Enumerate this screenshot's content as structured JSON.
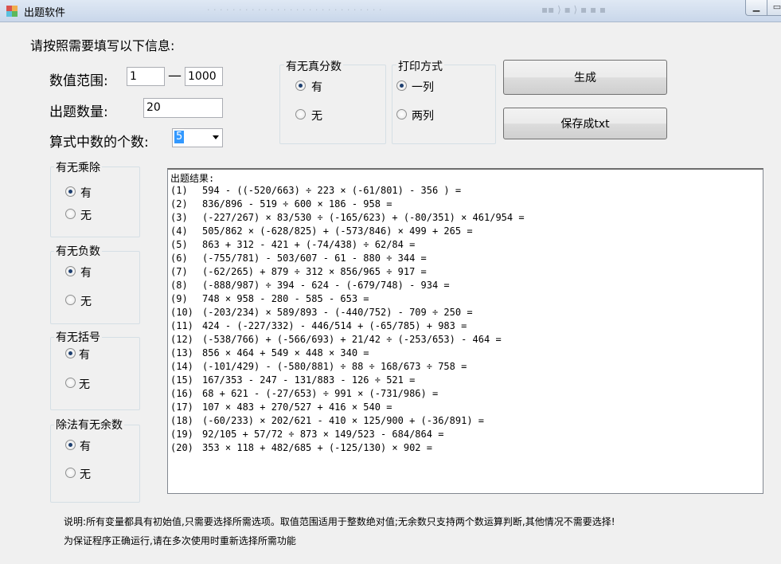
{
  "window": {
    "title": "出题软件",
    "url_ghost": "· · · · · · · · · · · · · · · · · · · · · · · · · · · ·",
    "tools_ghost": "▪▪ ⟩ ▪ ⟩ ▪ ▪ ▪",
    "min_label": "▁",
    "max_label": "▭"
  },
  "form": {
    "intro": "请按照需要填写以下信息:",
    "range_label": "数值范围:",
    "range_min": "1",
    "range_dash": "—",
    "range_max": "1000",
    "count_label": "出题数量:",
    "count_value": "20",
    "operands_label": "算式中数的个数:",
    "operands_value": "5"
  },
  "groups": {
    "fraction": {
      "title": "有无真分数",
      "yes": "有",
      "no": "无",
      "selected": "yes"
    },
    "print": {
      "title": "打印方式",
      "one": "一列",
      "two": "两列",
      "selected": "one"
    },
    "muldiv": {
      "title": "有无乘除",
      "yes": "有",
      "no": "无",
      "selected": "yes"
    },
    "negative": {
      "title": "有无负数",
      "yes": "有",
      "no": "无",
      "selected": "yes"
    },
    "brackets": {
      "title": "有无括号",
      "yes": "有",
      "no": "无",
      "selected": "yes"
    },
    "remainder": {
      "title": "除法有无余数",
      "yes": "有",
      "no": "无",
      "selected": "yes"
    }
  },
  "buttons": {
    "generate": "生成",
    "save": "保存成txt"
  },
  "results": {
    "header": "出题结果:",
    "items": [
      {
        "n": "(1)",
        "expr": "594 - ((-520/663) ÷ 223 × (-61/801) - 356 ) ="
      },
      {
        "n": "(2)",
        "expr": "836/896 - 519 ÷ 600 × 186 - 958 ="
      },
      {
        "n": "(3)",
        "expr": "(-227/267) × 83/530 ÷ (-165/623) + (-80/351) × 461/954 ="
      },
      {
        "n": "(4)",
        "expr": "505/862 × (-628/825) + (-573/846) × 499 + 265 ="
      },
      {
        "n": "(5)",
        "expr": "863 + 312 - 421 + (-74/438) ÷ 62/84 ="
      },
      {
        "n": "(6)",
        "expr": "(-755/781) - 503/607 - 61 - 880 ÷ 344 ="
      },
      {
        "n": "(7)",
        "expr": "(-62/265) + 879 ÷ 312 × 856/965 ÷ 917 ="
      },
      {
        "n": "(8)",
        "expr": "(-888/987) ÷ 394 - 624 - (-679/748) - 934 ="
      },
      {
        "n": "(9)",
        "expr": "748 × 958 - 280 - 585 - 653 ="
      },
      {
        "n": "(10)",
        "expr": "(-203/234) × 589/893 - (-440/752) - 709 ÷ 250 ="
      },
      {
        "n": "(11)",
        "expr": "424 - (-227/332) - 446/514 + (-65/785) + 983 ="
      },
      {
        "n": "(12)",
        "expr": "(-538/766) + (-566/693) + 21/42 ÷ (-253/653) - 464 ="
      },
      {
        "n": "(13)",
        "expr": "856 × 464 + 549 × 448 × 340 ="
      },
      {
        "n": "(14)",
        "expr": "(-101/429) - (-580/881) ÷ 88 ÷ 168/673 ÷ 758 ="
      },
      {
        "n": "(15)",
        "expr": "167/353 - 247 - 131/883 - 126 ÷ 521 ="
      },
      {
        "n": "(16)",
        "expr": "68 + 621 - (-27/653) ÷ 991 × (-731/986) ="
      },
      {
        "n": "(17)",
        "expr": "107 × 483 + 270/527 + 416 × 540 ="
      },
      {
        "n": "(18)",
        "expr": "(-60/233) × 202/621 - 410 × 125/900 + (-36/891) ="
      },
      {
        "n": "(19)",
        "expr": "92/105 + 57/72 ÷ 873 × 149/523 - 684/864 ="
      },
      {
        "n": "(20)",
        "expr": "353 × 118 + 482/685 + (-125/130) × 902 ="
      }
    ]
  },
  "notes": {
    "line1": "说明:所有变量都具有初始值,只需要选择所需选项。取值范围适用于整数绝对值;无余数只支持两个数运算判断,其他情况不需要选择!",
    "line2": "为保证程序正确运行,请在多次使用时重新选择所需功能"
  }
}
